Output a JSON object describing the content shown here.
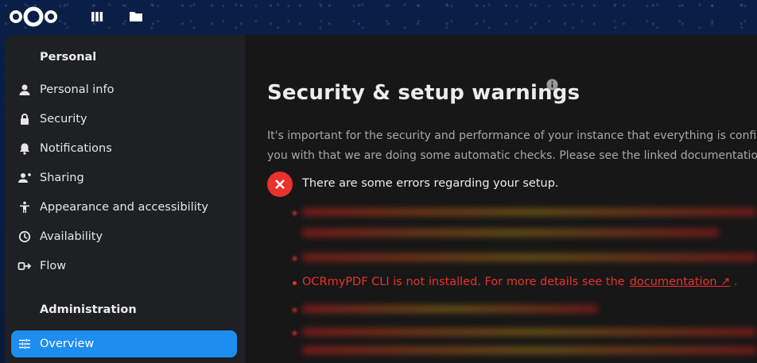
{
  "topbar": {
    "icons": [
      "nextcloud-logo",
      "dashboard-icon",
      "files-icon"
    ]
  },
  "sidebar": {
    "personal_title": "Personal",
    "personal_items": [
      {
        "label": "Personal info",
        "icon": "user-icon"
      },
      {
        "label": "Security",
        "icon": "lock-icon"
      },
      {
        "label": "Notifications",
        "icon": "bell-icon"
      },
      {
        "label": "Sharing",
        "icon": "share-icon"
      },
      {
        "label": "Appearance and accessibility",
        "icon": "accessibility-icon"
      },
      {
        "label": "Availability",
        "icon": "clock-icon"
      },
      {
        "label": "Flow",
        "icon": "flow-icon"
      }
    ],
    "admin_title": "Administration",
    "admin_items": [
      {
        "label": "Overview",
        "icon": "tune-icon",
        "active": true
      }
    ]
  },
  "main": {
    "title": "Security & setup warnings",
    "description": "It's important for the security and performance of your instance that everything is configured correctly. To help you with that we are doing some automatic checks. Please see the linked documentation for more information.",
    "error_summary": "There are some errors regarding your setup.",
    "ocr_warning": "OCRmyPDF CLI is not installed. For more details see the",
    "ocr_link": "documentation ↗",
    "ocr_tail": "."
  },
  "colors": {
    "accent": "#1d8df0",
    "error": "#e9322d"
  }
}
